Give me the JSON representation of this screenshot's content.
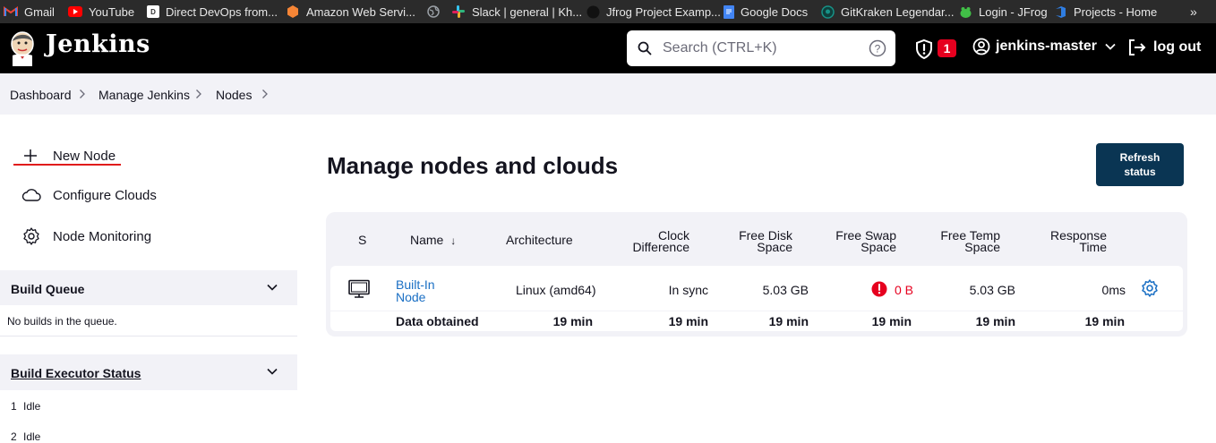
{
  "bookmarks": [
    {
      "label": "Gmail",
      "icon": "gmail-icon",
      "color": "#ea4335"
    },
    {
      "label": "YouTube",
      "icon": "youtube-icon",
      "color": "#ff0000"
    },
    {
      "label": "Direct DevOps from...",
      "icon": "page-icon",
      "color": "#ffffff"
    },
    {
      "label": "Amazon Web Servi...",
      "icon": "aws-icon",
      "color": "#f58536"
    },
    {
      "label": "",
      "icon": "globe-icon",
      "color": "#9aa0a6"
    },
    {
      "label": "Slack | general | Kh...",
      "icon": "slack-icon",
      "color": "#e01e5a"
    },
    {
      "label": "Jfrog Project Examp...",
      "icon": "github-icon",
      "color": "#222222"
    },
    {
      "label": "Google Docs",
      "icon": "docs-icon",
      "color": "#4285f4"
    },
    {
      "label": "GitKraken Legendar...",
      "icon": "gitkraken-icon",
      "color": "#179287"
    },
    {
      "label": "Login - JFrog",
      "icon": "jfrog-icon",
      "color": "#41bf47"
    },
    {
      "label": "Projects - Home",
      "icon": "azure-devops-icon",
      "color": "#2f7de1"
    }
  ],
  "bookmarks_more": "»",
  "header": {
    "brand": "Jenkins",
    "search_placeholder": "Search (CTRL+K)",
    "alert_count": "1",
    "username": "jenkins-master",
    "logout": "log out"
  },
  "breadcrumbs": [
    "Dashboard",
    "Manage Jenkins",
    "Nodes"
  ],
  "sidebar": {
    "tasks": [
      {
        "label": "New Node",
        "icon": "plus-icon"
      },
      {
        "label": "Configure Clouds",
        "icon": "cloud-icon"
      },
      {
        "label": "Node Monitoring",
        "icon": "gear-icon"
      }
    ],
    "build_queue": {
      "title": "Build Queue",
      "empty": "No builds in the queue."
    },
    "executor_status": {
      "title": "Build Executor Status",
      "executors": [
        {
          "num": "1",
          "state": "Idle"
        },
        {
          "num": "2",
          "state": "Idle"
        }
      ]
    }
  },
  "main": {
    "title": "Manage nodes and clouds",
    "refresh_line1": "Refresh",
    "refresh_line2": "status",
    "columns": {
      "s": "S",
      "name": "Name",
      "sort_arrow": "↓",
      "architecture": "Architecture",
      "clock_1": "Clock",
      "clock_2": "Difference",
      "disk_1": "Free Disk",
      "disk_2": "Space",
      "swap_1": "Free Swap",
      "swap_2": "Space",
      "temp_1": "Free Temp",
      "temp_2": "Space",
      "resp_1": "Response",
      "resp_2": "Time"
    },
    "node": {
      "name_1": "Built-In",
      "name_2": "Node",
      "architecture": "Linux (amd64)",
      "clock": "In sync",
      "disk": "5.03 GB",
      "swap": "0 B",
      "temp": "5.03 GB",
      "response": "0ms"
    },
    "obtained": {
      "label": "Data obtained",
      "architecture": "19 min",
      "clock": "19 min",
      "disk": "19 min",
      "swap": "19 min",
      "temp": "19 min",
      "response": "19 min"
    }
  },
  "colors": {
    "accent": "#0a3553",
    "link": "#1a6fc4",
    "danger": "#e6001f"
  }
}
